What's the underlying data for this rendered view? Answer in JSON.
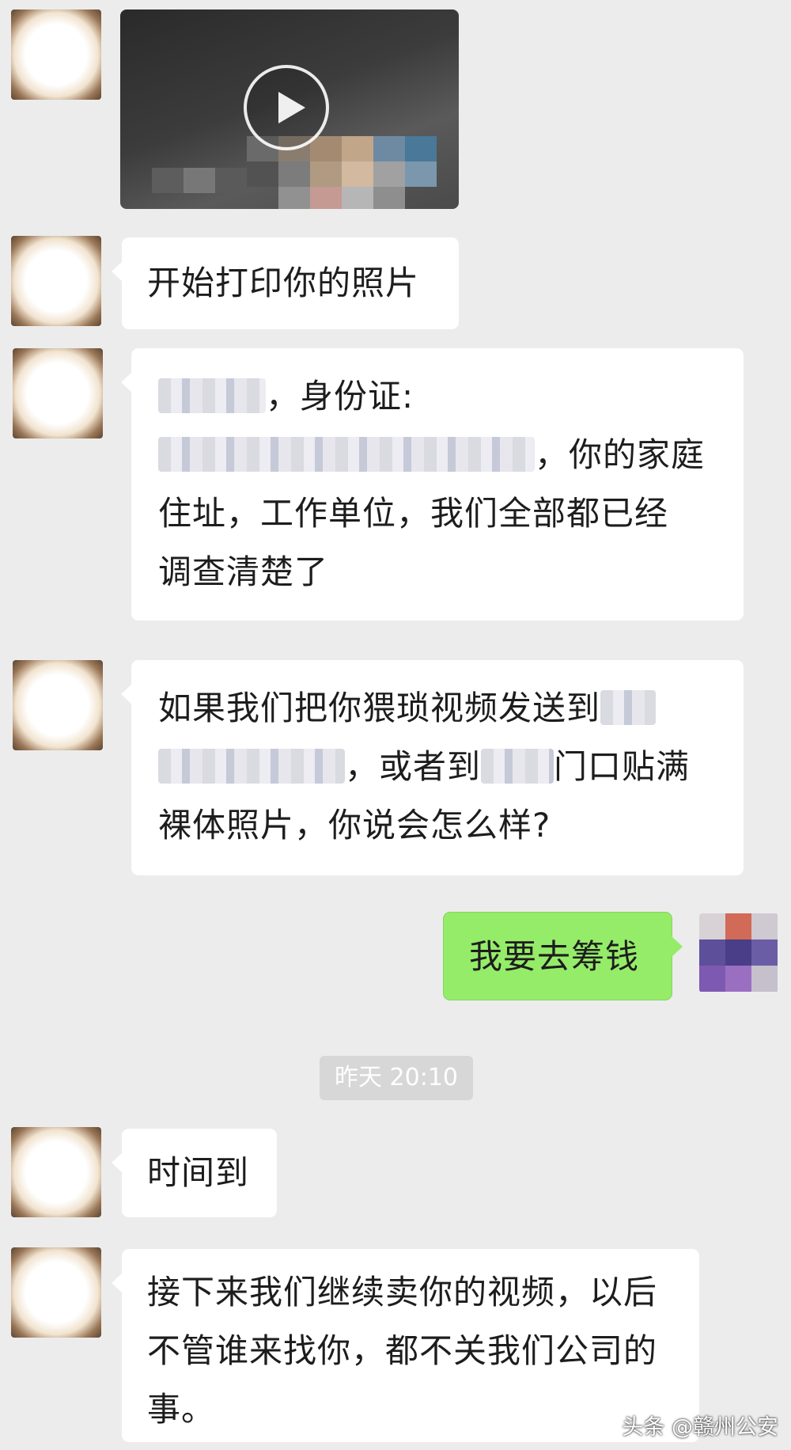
{
  "messages": [
    {
      "id": "m1",
      "type": "video",
      "side": "left"
    },
    {
      "id": "m2",
      "side": "left",
      "text": "开始打印你的照片"
    },
    {
      "id": "m3",
      "side": "left",
      "lines": [
        "，身份证:",
        "，你的家庭",
        "住址，工作单位，我们全部都已经",
        "调查清楚了"
      ]
    },
    {
      "id": "m4",
      "side": "left",
      "lines": [
        "如果我们把你猥琐视频发送到",
        "，或者到",
        "门口贴满",
        "裸体照片，你说会怎么样?"
      ]
    },
    {
      "id": "m5",
      "side": "right",
      "text": "我要去筹钱"
    },
    {
      "id": "m6",
      "side": "left",
      "text": "时间到"
    },
    {
      "id": "m7",
      "side": "left",
      "lines": [
        "接下来我们继续卖你的视频，以后",
        "不管谁来找你，都不关我们公司的",
        "事。"
      ]
    }
  ],
  "timestamp": "昨天 20:10",
  "watermark": "头条 @赣州公安",
  "colors": {
    "background": "#ececec",
    "bubble_incoming": "#ffffff",
    "bubble_outgoing": "#95ec69",
    "timestamp_bg": "#d7d7d7"
  },
  "icons": {
    "video_play": "play-icon"
  }
}
